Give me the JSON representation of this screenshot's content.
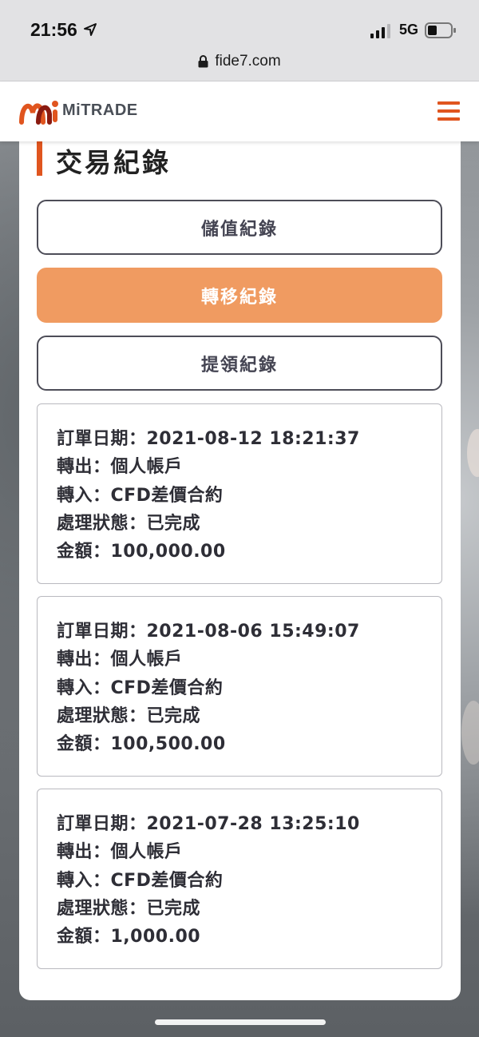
{
  "status_bar": {
    "time": "21:56",
    "network": "5G",
    "url": "fide7.com"
  },
  "header": {
    "brand": "MiTRADE",
    "brand_color": "#e0551f",
    "menu_icon": "hamburger-menu-icon"
  },
  "page": {
    "title": "交易紀錄"
  },
  "tabs": [
    {
      "label": "儲值紀錄",
      "active": false
    },
    {
      "label": "轉移紀錄",
      "active": true
    },
    {
      "label": "提領紀錄",
      "active": false
    }
  ],
  "active_tab_color": "#f09b61",
  "records": [
    {
      "date": "訂單日期：2021-08-12 18:21:37",
      "from": "轉出：個人帳戶",
      "to": "轉入：CFD差價合約",
      "status": "處理狀態：已完成",
      "amount": "金額：100,000.00"
    },
    {
      "date": "訂單日期：2021-08-06 15:49:07",
      "from": "轉出：個人帳戶",
      "to": "轉入：CFD差價合約",
      "status": "處理狀態：已完成",
      "amount": "金額：100,500.00"
    },
    {
      "date": "訂單日期：2021-07-28 13:25:10",
      "from": "轉出：個人帳戶",
      "to": "轉入：CFD差價合約",
      "status": "處理狀態：已完成",
      "amount": "金額：1,000.00"
    }
  ]
}
